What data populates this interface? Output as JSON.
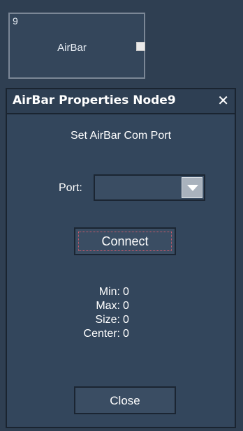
{
  "node": {
    "id": "9",
    "label": "AirBar"
  },
  "dialog": {
    "title": "AirBar Properties Node9",
    "close_icon": "close-icon",
    "subtitle": "Set AirBar Com Port",
    "port_label": "Port:",
    "port_value": "",
    "connect_label": "Connect",
    "close_label": "Close",
    "stats": [
      {
        "label": "Min:",
        "value": "0"
      },
      {
        "label": "Max:",
        "value": "0"
      },
      {
        "label": "Size:",
        "value": "0"
      },
      {
        "label": "Center:",
        "value": "0"
      }
    ]
  },
  "colors": {
    "background": "#2f3f52",
    "dialog": "#33465c",
    "text": "#ffffff",
    "focus_outline": "#d35a6a"
  }
}
